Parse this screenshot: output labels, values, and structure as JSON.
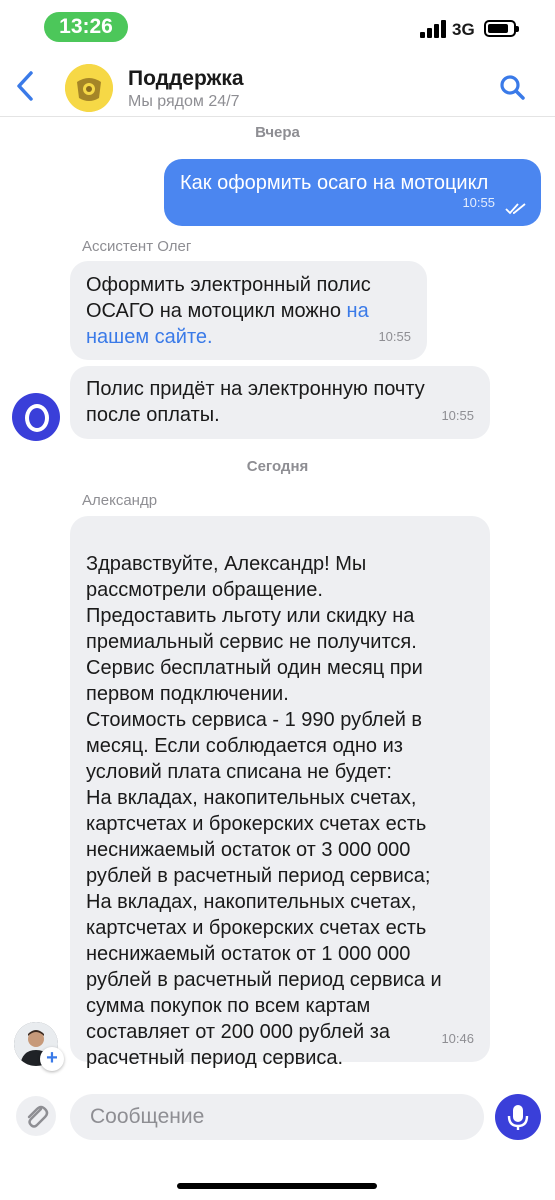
{
  "status_bar": {
    "time": "13:26",
    "network": "3G"
  },
  "header": {
    "title": "Поддержка",
    "subtitle": "Мы рядом 24/7"
  },
  "messages": {
    "date_yesterday": "Вчера",
    "date_today": "Сегодня",
    "m1": {
      "text": "Как оформить осаго на мотоцикл",
      "time": "10:55"
    },
    "m2": {
      "sender": "Ассистент Олег",
      "text": "Оформить электронный полис ОСАГО на мотоцикл можно ",
      "link": "на нашем сайте.",
      "time": "10:55"
    },
    "m3": {
      "text": "Полис придёт на электронную почту после оплаты.",
      "time": "10:55"
    },
    "m4": {
      "sender": "Александр",
      "text": "Здравствуйте, Александр! Мы рассмотрели обращение.\nПредоставить льготу или скидку на премиальный сервис не получится. Сервис бесплатный один месяц при первом подключении.\nСтоимость сервиса - 1 990 рублей в месяц. Если соблюдается одно из условий плата списана не будет:\nНа вкладах, накопительных счетах, картсчетах и брокерских счетах есть неснижаемый остаток от 3 000 000 рублей в расчетный период сервиса;\nНа вкладах, накопительных счетах, картсчетах и брокерских счетах есть неснижаемый остаток от 1 000 000 рублей в расчетный период сервиса и сумма покупок по всем картам составляет от 200 000 рублей за расчетный период сервиса.",
      "time": "10:46"
    }
  },
  "input": {
    "placeholder": "Сообщение"
  },
  "colors": {
    "accent": "#3a3fd9",
    "outgoing_bubble": "#4b86f0",
    "incoming_bubble": "#eeeff2",
    "link": "#3a7ae8"
  },
  "icons": [
    "back-chevron-icon",
    "search-icon",
    "paperclip-icon",
    "microphone-icon",
    "double-check-icon",
    "plus-icon"
  ]
}
